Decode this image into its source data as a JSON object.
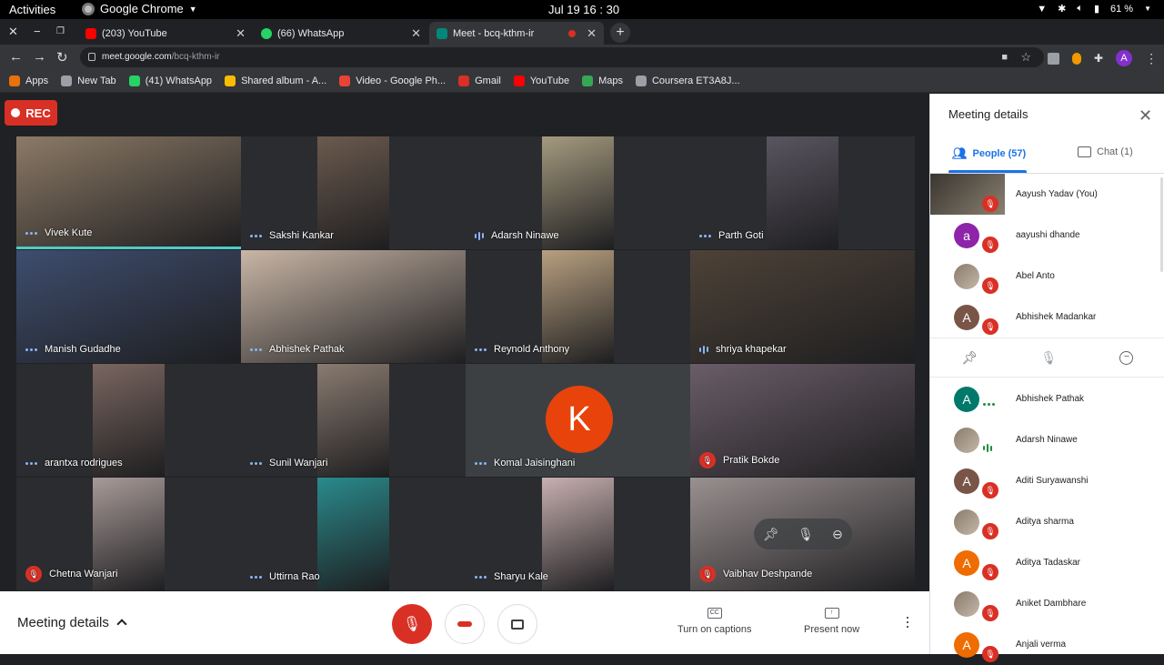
{
  "system": {
    "activities": "Activities",
    "app": "Google Chrome",
    "clock": "Jul 19  16 : 30",
    "battery": "61 %"
  },
  "tabs": [
    {
      "title": "(203) YouTube",
      "color": "#ff0000"
    },
    {
      "title": "(66) WhatsApp",
      "color": "#25d366"
    },
    {
      "title": "Meet - bcq-kthm-ir",
      "color": "#00897b"
    }
  ],
  "address": {
    "host": "meet.google.com",
    "path": "/bcq-kthm-ir",
    "profile": "A"
  },
  "bookmarks": [
    {
      "label": "Apps",
      "color": "#e8710a"
    },
    {
      "label": "New Tab",
      "color": "#9aa0a6"
    },
    {
      "label": "(41) WhatsApp",
      "color": "#25d366"
    },
    {
      "label": "Shared album - A...",
      "color": "#fbbc04"
    },
    {
      "label": "Video - Google Ph...",
      "color": "#ea4335"
    },
    {
      "label": "Gmail",
      "color": "#d93025"
    },
    {
      "label": "YouTube",
      "color": "#ff0000"
    },
    {
      "label": "Maps",
      "color": "#34a853"
    },
    {
      "label": "Coursera ET3A8J...",
      "color": "#9aa0a6"
    }
  ],
  "meet": {
    "rec": "REC",
    "tiles": [
      {
        "name": "Vivek Kute",
        "status": "dots",
        "bg": "#8c7a66"
      },
      {
        "name": "Sakshi Kankar",
        "status": "dots",
        "bg": "#6b5a4e"
      },
      {
        "name": "Adarsh Ninawe",
        "status": "bars",
        "bg": "#a59a7f"
      },
      {
        "name": "Parth Goti",
        "status": "dots",
        "bg": "#5a5560"
      },
      {
        "name": "Manish Gudadhe",
        "status": "dots",
        "bg": "#3e4d6e"
      },
      {
        "name": "Abhishek Pathak",
        "status": "dots",
        "bg": "#c9b6a6"
      },
      {
        "name": "Reynold Anthony",
        "status": "dots",
        "bg": "#b8a080"
      },
      {
        "name": "shriya khapekar",
        "status": "bars",
        "bg": "#4d4237"
      },
      {
        "name": "arantxa rodrigues",
        "status": "dots",
        "bg": "#7a6660"
      },
      {
        "name": "Sunil Wanjari",
        "status": "dots",
        "bg": "#8a7b70"
      },
      {
        "name": "Komal Jaisinghani",
        "status": "dots",
        "avatar": "K"
      },
      {
        "name": "Pratik Bokde",
        "status": "muted",
        "bg": "#6a5d68"
      },
      {
        "name": "Chetna Wanjari",
        "status": "muted",
        "bg": "#a89a98"
      },
      {
        "name": "Uttirna Rao",
        "status": "dots",
        "bg": "#2a8a8c"
      },
      {
        "name": "Sharyu Kale",
        "status": "dots",
        "bg": "#c8b0b0"
      },
      {
        "name": "Vaibhav Deshpande",
        "status": "muted",
        "bg": "#9a9090"
      }
    ],
    "bottom": {
      "meeting_details": "Meeting details",
      "captions": "Turn on captions",
      "present": "Present now"
    }
  },
  "panel": {
    "title": "Meeting details",
    "people_tab": "People (57)",
    "chat_tab": "Chat (1)",
    "top_list": [
      {
        "name": "Aayush Yadav (You)",
        "avatar": "",
        "type": "square",
        "status": "muted"
      },
      {
        "name": "aayushi dhande",
        "avatar": "a",
        "color": "#8e24aa",
        "status": "muted"
      },
      {
        "name": "Abel Anto",
        "avatar": "",
        "type": "photo",
        "status": "muted"
      },
      {
        "name": "Abhishek Madankar",
        "avatar": "A",
        "color": "#795548",
        "status": "muted"
      }
    ],
    "list": [
      {
        "name": "Abhishek Pathak",
        "avatar": "A",
        "color": "#00796b",
        "status": "dots"
      },
      {
        "name": "Adarsh Ninawe",
        "avatar": "",
        "type": "photo",
        "status": "bars"
      },
      {
        "name": "Aditi Suryawanshi",
        "avatar": "A",
        "color": "#795548",
        "status": "muted"
      },
      {
        "name": "Aditya sharma",
        "avatar": "",
        "type": "photo",
        "status": "muted"
      },
      {
        "name": "Aditya Tadaskar",
        "avatar": "A",
        "color": "#ef6c00",
        "status": "muted"
      },
      {
        "name": "Aniket Dambhare",
        "avatar": "",
        "type": "photo",
        "status": "muted"
      },
      {
        "name": "Anjali verma",
        "avatar": "A",
        "color": "#ef6c00",
        "status": "muted"
      }
    ]
  }
}
